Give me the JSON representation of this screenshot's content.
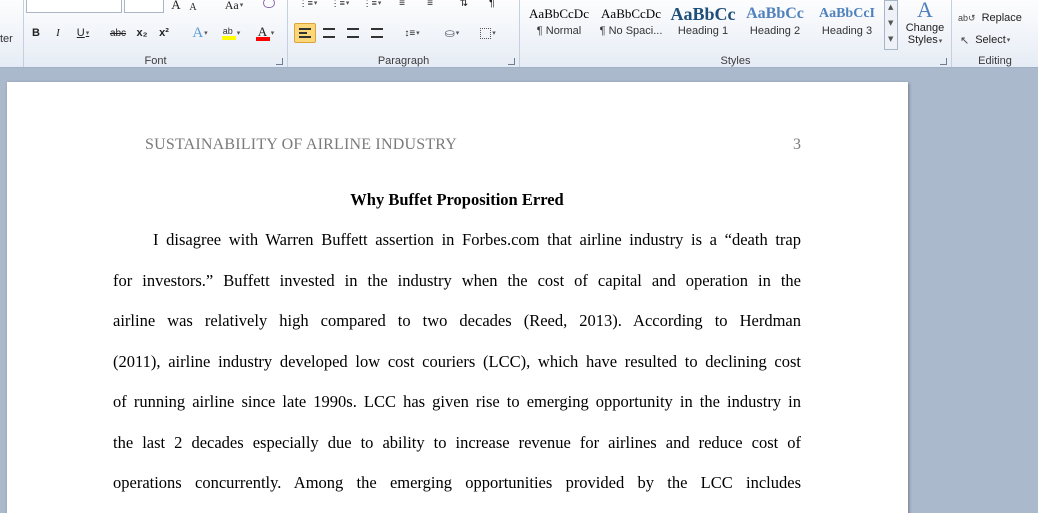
{
  "ribbon": {
    "font_group": {
      "label": "Font",
      "partial_left_label": "ter",
      "bold": "B",
      "italic": "I",
      "underline": "U",
      "strikethrough": "abc",
      "subscript": "x₂",
      "superscript": "x²",
      "grow_font": "A",
      "shrink_font": "A",
      "change_case": "Aa"
    },
    "paragraph_group": {
      "label": "Paragraph"
    },
    "styles_group": {
      "label": "Styles",
      "tiles": [
        {
          "sample": "AaBbCcDc",
          "name": "¶ Normal"
        },
        {
          "sample": "AaBbCcDc",
          "name": "¶ No Spaci..."
        },
        {
          "sample": "AaBbCc",
          "name": "Heading 1"
        },
        {
          "sample": "AaBbCc",
          "name": "Heading 2"
        },
        {
          "sample": "AaBbCcI",
          "name": "Heading 3"
        }
      ],
      "change_styles_line1": "Change",
      "change_styles_line2": "Styles"
    },
    "editing_group": {
      "label": "Editing",
      "replace": "Replace",
      "select": "Select"
    }
  },
  "colors": {
    "heading1": "#1f4e79",
    "heading2": "#4f81bd",
    "highlight": "#ffff00",
    "font_color": "#ff0000",
    "running_head": "#7a7a7a"
  },
  "document": {
    "running_head": "SUSTAINABILITY OF AIRLINE INDUSTRY",
    "page_number": "3",
    "heading": "Why Buffet Proposition Erred",
    "lines": [
      "I disagree with Warren Buffett assertion in Forbes.com that airline industry is a “death trap",
      "for investors.” Buffett invested in the industry when the cost of capital and operation in the",
      "airline was relatively high compared to two decades (Reed, 2013). According to Herdman",
      "(2011), airline industry developed low cost couriers (LCC), which have resulted to declining cost",
      "of running airline since late 1990s. LCC has given rise to emerging opportunity in the industry in",
      "the last 2 decades especially due to ability to increase revenue for airlines and reduce cost of",
      "operations concurrently. Among the emerging opportunities provided by the LCC includes"
    ]
  }
}
